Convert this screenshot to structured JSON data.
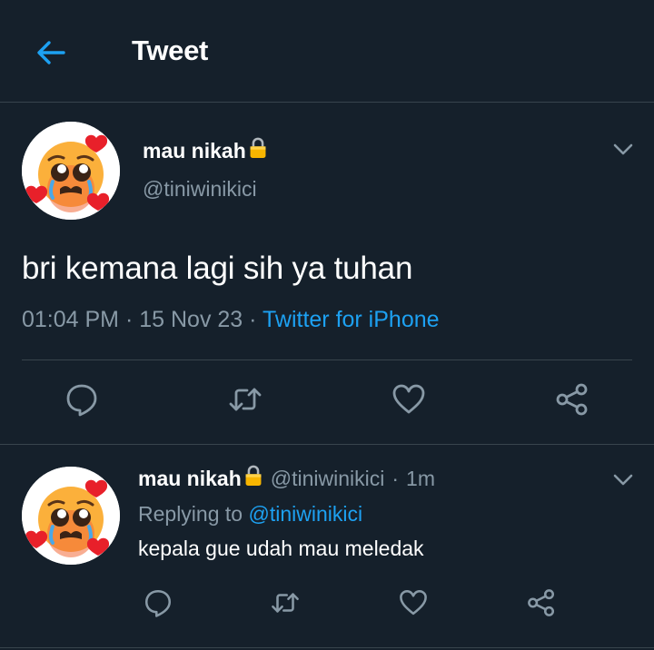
{
  "header": {
    "title": "Tweet"
  },
  "tweet": {
    "display_name": "mau nikah",
    "handle": "@tiniwinikici",
    "text": "bri kemana lagi sih ya tuhan",
    "time": "01:04 PM",
    "date": "15 Nov 23",
    "separator": "·",
    "source": "Twitter for iPhone"
  },
  "reply": {
    "display_name": "mau nikah",
    "handle": "@tiniwinikici",
    "separator": "·",
    "age": "1m",
    "replying_prefix": "Replying to",
    "replying_to": "@tiniwinikici",
    "text": "kepala gue udah mau meledak"
  },
  "colors": {
    "background": "#15202b",
    "accent": "#1da1f2",
    "muted": "#8899a6",
    "divider": "#38444d"
  },
  "icons": [
    "back-arrow-icon",
    "lock-icon",
    "chevron-down-icon",
    "reply-icon",
    "retweet-icon",
    "like-icon",
    "share-icon"
  ]
}
